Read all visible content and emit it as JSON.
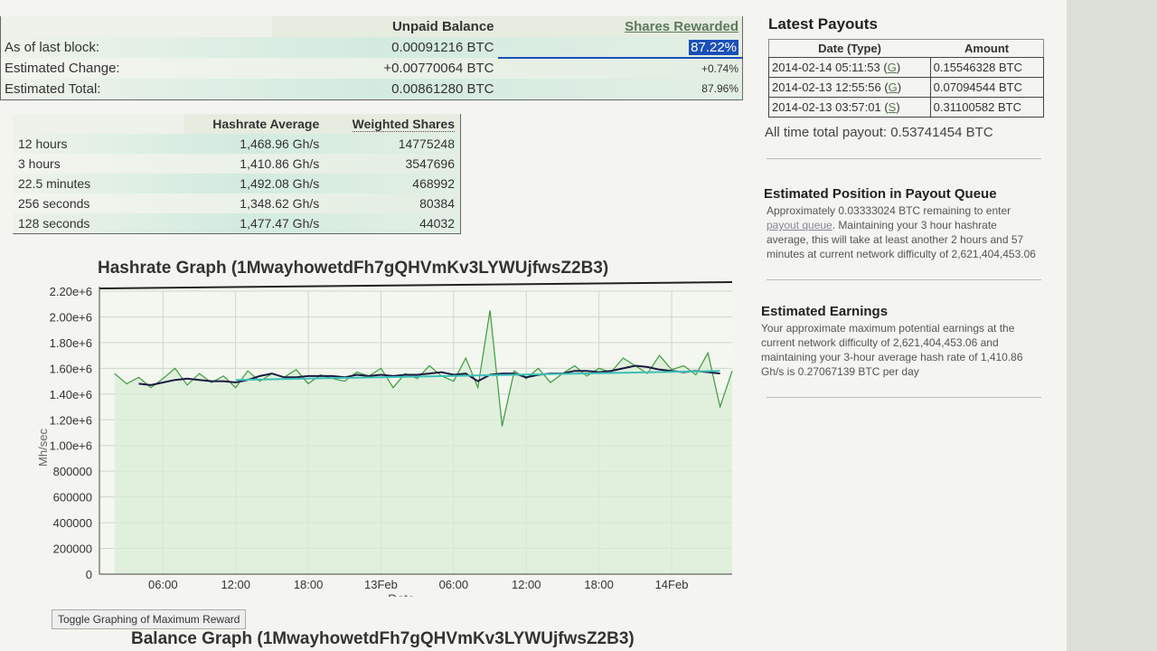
{
  "balance": {
    "headers": {
      "unpaid": "Unpaid Balance",
      "shares": "Shares Rewarded"
    },
    "rows": [
      {
        "label": "As of last block:",
        "value": "0.00091216 BTC",
        "pct": "87.22%"
      },
      {
        "label": "Estimated Change:",
        "value": "+0.00770064 BTC",
        "pct": "+0.74%"
      },
      {
        "label": "Estimated Total:",
        "value": "0.00861280 BTC",
        "pct": "87.96%"
      }
    ]
  },
  "hashrate": {
    "headers": {
      "avg": "Hashrate Average",
      "shares": "Weighted Shares"
    },
    "rows": [
      {
        "period": "12 hours",
        "avg": "1,468.96 Gh/s",
        "shares": "14775248"
      },
      {
        "period": "3 hours",
        "avg": "1,410.86 Gh/s",
        "shares": "3547696"
      },
      {
        "period": "22.5 minutes",
        "avg": "1,492.08 Gh/s",
        "shares": "468992"
      },
      {
        "period": "256 seconds",
        "avg": "1,348.62 Gh/s",
        "shares": "80384"
      },
      {
        "period": "128 seconds",
        "avg": "1,477.47 Gh/s",
        "shares": "44032"
      }
    ]
  },
  "payouts": {
    "title": "Latest Payouts",
    "headers": {
      "date": "Date (Type)",
      "amount": "Amount"
    },
    "rows": [
      {
        "date": "2014-02-14 05:11:53",
        "type": "G",
        "amount": "0.15546328 BTC"
      },
      {
        "date": "2014-02-13 12:55:56",
        "type": "G",
        "amount": "0.07094544 BTC"
      },
      {
        "date": "2014-02-13 03:57:01",
        "type": "S",
        "amount": "0.31100582 BTC"
      }
    ],
    "total": "All time total payout: 0.53741454 BTC"
  },
  "queue": {
    "title": "Estimated Position in Payout Queue",
    "pre": "Approximately 0.03333024 BTC remaining to enter ",
    "link": "payout queue",
    "post": ". Maintaining your 3 hour hashrate average, this will take at least another 2 hours and 57 minutes at current network difficulty of 2,621,404,453.06"
  },
  "earnings": {
    "title": "Estimated Earnings",
    "text": "Your approximate maximum potential earnings at the current network difficulty of 2,621,404,453.06 and maintaining your 3-hour average hash rate of 1,410.86 Gh/s is 0.27067139 BTC per day"
  },
  "toggle_button": "Toggle Graphing of Maximum Reward",
  "balance_graph_title": "Balance Graph (1MwayhowetdFh7gQHVmKv3LYWUjfwsZ2B3)",
  "chart_data": {
    "type": "line",
    "title": "Hashrate Graph (1MwayhowetdFh7gQHVmKv3LYWUjfwsZ2B3)",
    "xlabel": "Date",
    "ylabel": "Mh/sec",
    "ylim": [
      0,
      2200000
    ],
    "yticks": [
      "0",
      "200000",
      "400000",
      "600000",
      "800000",
      "1.00e+6",
      "1.20e+6",
      "1.40e+6",
      "1.60e+6",
      "1.80e+6",
      "2.00e+6",
      "2.20e+6"
    ],
    "xticks": [
      {
        "t": "2014-02-12T06:00",
        "label": "06:00"
      },
      {
        "t": "2014-02-12T12:00",
        "label": "12:00"
      },
      {
        "t": "2014-02-12T18:00",
        "label": "18:00"
      },
      {
        "t": "2014-02-13T00:00",
        "label": "13Feb"
      },
      {
        "t": "2014-02-13T06:00",
        "label": "06:00"
      },
      {
        "t": "2014-02-13T12:00",
        "label": "12:00"
      },
      {
        "t": "2014-02-13T18:00",
        "label": "18:00"
      },
      {
        "t": "2014-02-14T00:00",
        "label": "14Feb"
      }
    ],
    "xlim": [
      "2014-02-12T00:45",
      "2014-02-14T05:00"
    ],
    "grid": true,
    "colors": {
      "hashrate": "#3d9a3d",
      "average": "#1a1a40",
      "trend": "#3cc0b8",
      "fill": "#d8ecd4"
    },
    "x": [
      "2014-02-12T02:00",
      "2014-02-12T03:00",
      "2014-02-12T04:00",
      "2014-02-12T05:00",
      "2014-02-12T06:00",
      "2014-02-12T07:00",
      "2014-02-12T08:00",
      "2014-02-12T09:00",
      "2014-02-12T10:00",
      "2014-02-12T11:00",
      "2014-02-12T12:00",
      "2014-02-12T13:00",
      "2014-02-12T14:00",
      "2014-02-12T15:00",
      "2014-02-12T16:00",
      "2014-02-12T17:00",
      "2014-02-12T18:00",
      "2014-02-12T19:00",
      "2014-02-12T20:00",
      "2014-02-12T21:00",
      "2014-02-12T22:00",
      "2014-02-12T23:00",
      "2014-02-13T00:00",
      "2014-02-13T01:00",
      "2014-02-13T02:00",
      "2014-02-13T03:00",
      "2014-02-13T04:00",
      "2014-02-13T05:00",
      "2014-02-13T06:00",
      "2014-02-13T07:00",
      "2014-02-13T08:00",
      "2014-02-13T09:00",
      "2014-02-13T10:00",
      "2014-02-13T11:00",
      "2014-02-13T12:00",
      "2014-02-13T13:00",
      "2014-02-13T14:00",
      "2014-02-13T15:00",
      "2014-02-13T16:00",
      "2014-02-13T17:00",
      "2014-02-13T18:00",
      "2014-02-13T19:00",
      "2014-02-13T20:00",
      "2014-02-13T21:00",
      "2014-02-13T22:00",
      "2014-02-13T23:00",
      "2014-02-14T00:00",
      "2014-02-14T01:00",
      "2014-02-14T02:00",
      "2014-02-14T03:00",
      "2014-02-14T04:00",
      "2014-02-14T05:00"
    ],
    "series": [
      {
        "key": "hashrate",
        "values": [
          1560000,
          1480000,
          1530000,
          1450000,
          1520000,
          1600000,
          1470000,
          1560000,
          1490000,
          1540000,
          1450000,
          1580000,
          1500000,
          1560000,
          1530000,
          1590000,
          1480000,
          1550000,
          1520000,
          1500000,
          1570000,
          1540000,
          1600000,
          1450000,
          1560000,
          1520000,
          1620000,
          1540000,
          1500000,
          1680000,
          1450000,
          2050000,
          1150000,
          1580000,
          1520000,
          1600000,
          1490000,
          1560000,
          1620000,
          1540000,
          1600000,
          1570000,
          1680000,
          1620000,
          1560000,
          1700000,
          1590000,
          1620000,
          1550000,
          1720000,
          1300000,
          1580000
        ]
      },
      {
        "key": "average",
        "values": [
          null,
          null,
          1480000,
          1470000,
          1490000,
          1510000,
          1520000,
          1510000,
          1500000,
          1500000,
          1490000,
          1510000,
          1540000,
          1560000,
          1530000,
          1530000,
          1540000,
          1540000,
          1540000,
          1530000,
          1550000,
          1540000,
          1550000,
          1540000,
          1550000,
          1550000,
          1560000,
          1570000,
          1550000,
          1560000,
          1500000,
          1550000,
          1560000,
          1560000,
          1530000,
          1550000,
          1560000,
          1560000,
          1580000,
          1580000,
          1570000,
          1580000,
          1600000,
          1620000,
          1610000,
          1590000,
          1580000,
          1570000,
          1580000,
          1570000,
          1560000,
          null
        ]
      },
      {
        "key": "trend",
        "x": [
          "2014-02-12T12:00",
          "2014-02-14T04:00"
        ],
        "values": [
          1510000,
          1580000
        ]
      }
    ]
  }
}
